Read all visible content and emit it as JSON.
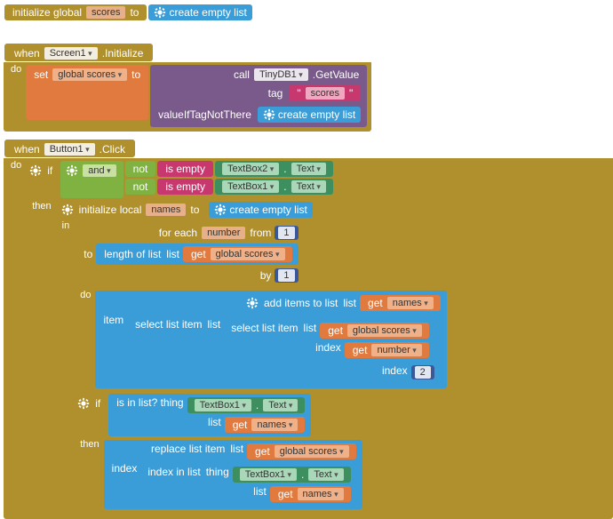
{
  "globals": {
    "init_label": "initialize global",
    "var": "scores",
    "to": "to"
  },
  "empty_list": "create empty list",
  "screen_init": {
    "when": "when",
    "comp": "Screen1",
    "evt": ".Initialize",
    "do": "do",
    "set": "set",
    "set_var": "global scores",
    "set_to": "to",
    "call": "call",
    "call_comp": "TinyDB1",
    "call_m": ".GetValue",
    "tag_k": "tag",
    "tag_v": "scores",
    "vnt": "valueIfTagNotThere"
  },
  "btn": {
    "when": "when",
    "comp": "Button1",
    "evt": ".Click",
    "do": "do",
    "if": "if",
    "and": "and",
    "not": "not",
    "isempty": "is empty",
    "tb2": "TextBox2",
    "tb1": "TextBox1",
    "text": "Text",
    "dot": ".",
    "then": "then",
    "init_local": "initialize local",
    "names": "names",
    "to": "to",
    "in": "in",
    "foreach": "for each",
    "number": "number",
    "from": "from",
    "to2": "to",
    "by": "by",
    "do2": "do",
    "from_v": "1",
    "by_v": "1",
    "len": "length of list",
    "list_k": "list",
    "get": "get",
    "gs": "global scores",
    "add": "add items to list",
    "item_k": "item",
    "sel": "select list item",
    "index_k": "index",
    "num": "number",
    "idx2": "2",
    "if2": "if",
    "inlist": "is in list? thing",
    "list2": "list",
    "then2": "then",
    "replace": "replace list item",
    "idxin": "index in list",
    "thing": "thing"
  }
}
